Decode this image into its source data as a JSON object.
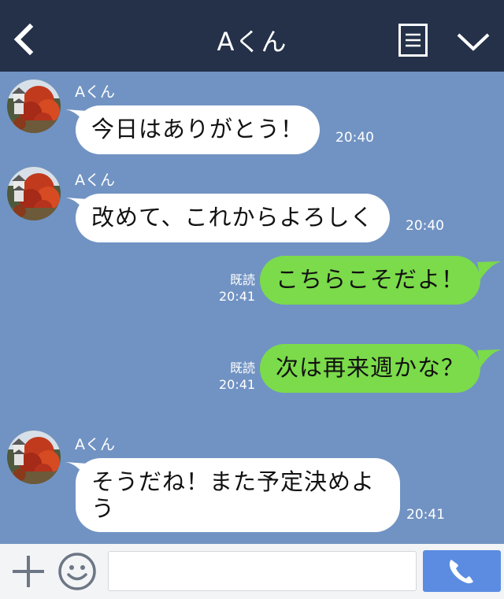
{
  "header": {
    "title": "Aくん"
  },
  "messages": [
    {
      "sender": "Aくん",
      "text": "今日はありがとう！",
      "time": "20:40"
    },
    {
      "sender": "Aくん",
      "text": "改めて、これからよろしく",
      "time": "20:40"
    },
    {
      "text": "こちらこそだよ！",
      "read": "既読",
      "time": "20:41"
    },
    {
      "text": "次は再来週かな？",
      "read": "既読",
      "time": "20:41"
    },
    {
      "sender": "Aくん",
      "line1": "そうだね！また予定決めよ",
      "line2": "う",
      "time": "20:41"
    }
  ],
  "colors": {
    "header_bg": "#243149",
    "chat_bg": "#7193c3",
    "outgoing_bubble": "#7bdb4a",
    "incoming_bubble": "#ffffff",
    "call_button": "#5b8ce2"
  },
  "icons": {
    "back": "chevron-left-icon",
    "menu": "menu-icon",
    "dropdown": "chevron-down-icon",
    "plus": "plus-icon",
    "emoji": "smiley-icon",
    "call": "phone-icon"
  }
}
